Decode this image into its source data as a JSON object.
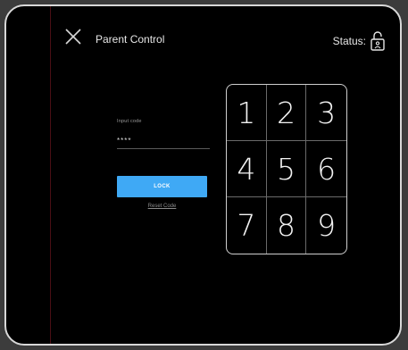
{
  "header": {
    "title": "Parent Control",
    "status_label": "Status:",
    "status_icon": "unlocked-padlock-icon"
  },
  "code_entry": {
    "label": "Input code",
    "value": "****"
  },
  "actions": {
    "lock_label": "LOCK",
    "reset_label": "Reset Code"
  },
  "keypad": {
    "keys": [
      "1",
      "2",
      "3",
      "4",
      "5",
      "6",
      "7",
      "8",
      "9"
    ]
  },
  "colors": {
    "accent": "#3fa9f5",
    "background": "#000000",
    "frame": "#d8d8d8"
  }
}
